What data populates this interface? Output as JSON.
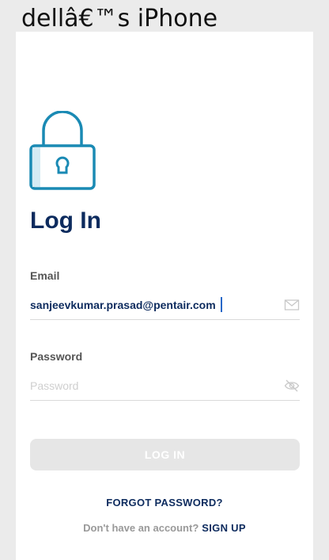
{
  "window": {
    "title": "dellâ€™s iPhone"
  },
  "login": {
    "title": "Log In",
    "email": {
      "label": "Email",
      "value": "sanjeevkumar.prasad@pentair.com",
      "icon": "envelope-icon"
    },
    "password": {
      "label": "Password",
      "placeholder": "Password",
      "icon": "eye-slash-icon"
    },
    "login_button": "LOG IN",
    "forgot_password": "FORGOT PASSWORD?",
    "signup_prompt": "Don't have an account?",
    "signup_link": "SIGN UP"
  },
  "colors": {
    "brand_navy": "#0d2b5e",
    "lock_teal": "#1a8ab4",
    "button_disabled": "#e6e6e6",
    "background": "#ebebeb"
  }
}
